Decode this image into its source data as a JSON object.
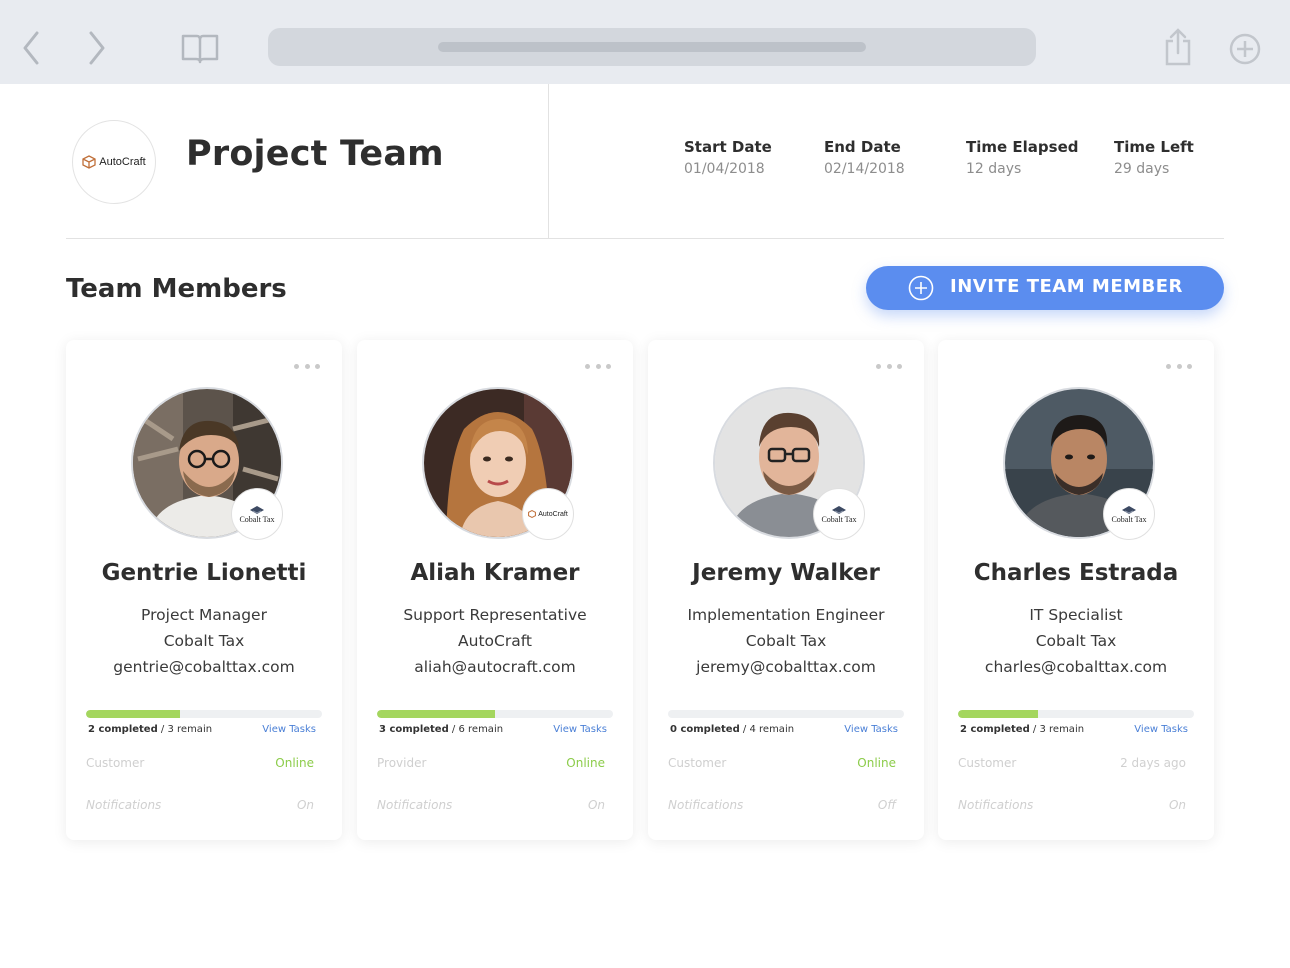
{
  "browser": {
    "icons": {
      "back": "chevron-left-icon",
      "forward": "chevron-right-icon",
      "reader": "book-icon",
      "share": "share-icon",
      "new_tab": "plus-circle-icon"
    }
  },
  "header": {
    "logo_text": "AutoCraft",
    "title": "Project Team",
    "stats": [
      {
        "label": "Start Date",
        "value": "01/04/2018"
      },
      {
        "label": "End Date",
        "value": "02/14/2018"
      },
      {
        "label": "Time Elapsed",
        "value": "12 days"
      },
      {
        "label": "Time Left",
        "value": "29 days"
      }
    ]
  },
  "section": {
    "title": "Team Members",
    "invite_label": "INVITE TEAM MEMBER"
  },
  "colors": {
    "accent": "#5b8def",
    "progress": "#a4d65e",
    "online": "#8ccc4a",
    "link": "#4a7fd6"
  },
  "members": [
    {
      "name": "Gentrie Lionetti",
      "role": "Project Manager",
      "company": "Cobalt Tax",
      "email": "gentrie@cobalttax.com",
      "badge": "Cobalt Tax",
      "completed": "2 completed",
      "remain": "3 remain",
      "progress": 0.4,
      "view_tasks": "View Tasks",
      "type": "Customer",
      "status": "Online",
      "notif_label": "Notifications",
      "notif_value": "On"
    },
    {
      "name": "Aliah Kramer",
      "role": "Support Representative",
      "company": "AutoCraft",
      "email": "aliah@autocraft.com",
      "badge": "AutoCraft",
      "completed": "3 completed",
      "remain": "6 remain",
      "progress": 0.5,
      "view_tasks": "View Tasks",
      "type": "Provider",
      "status": "Online",
      "notif_label": "Notifications",
      "notif_value": "On"
    },
    {
      "name": "Jeremy Walker",
      "role": "Implementation Engineer",
      "company": "Cobalt Tax",
      "email": "jeremy@cobalttax.com",
      "badge": "Cobalt Tax",
      "completed": "0 completed",
      "remain": "4 remain",
      "progress": 0,
      "view_tasks": "View Tasks",
      "type": "Customer",
      "status": "Online",
      "notif_label": "Notifications",
      "notif_value": "Off"
    },
    {
      "name": "Charles Estrada",
      "role": "IT Specialist",
      "company": "Cobalt Tax",
      "email": "charles@cobalttax.com",
      "badge": "Cobalt Tax",
      "completed": "2 completed",
      "remain": "3 remain",
      "progress": 0.34,
      "view_tasks": "View Tasks",
      "type": "Customer",
      "status": "2 days ago",
      "notif_label": "Notifications",
      "notif_value": "On"
    }
  ]
}
